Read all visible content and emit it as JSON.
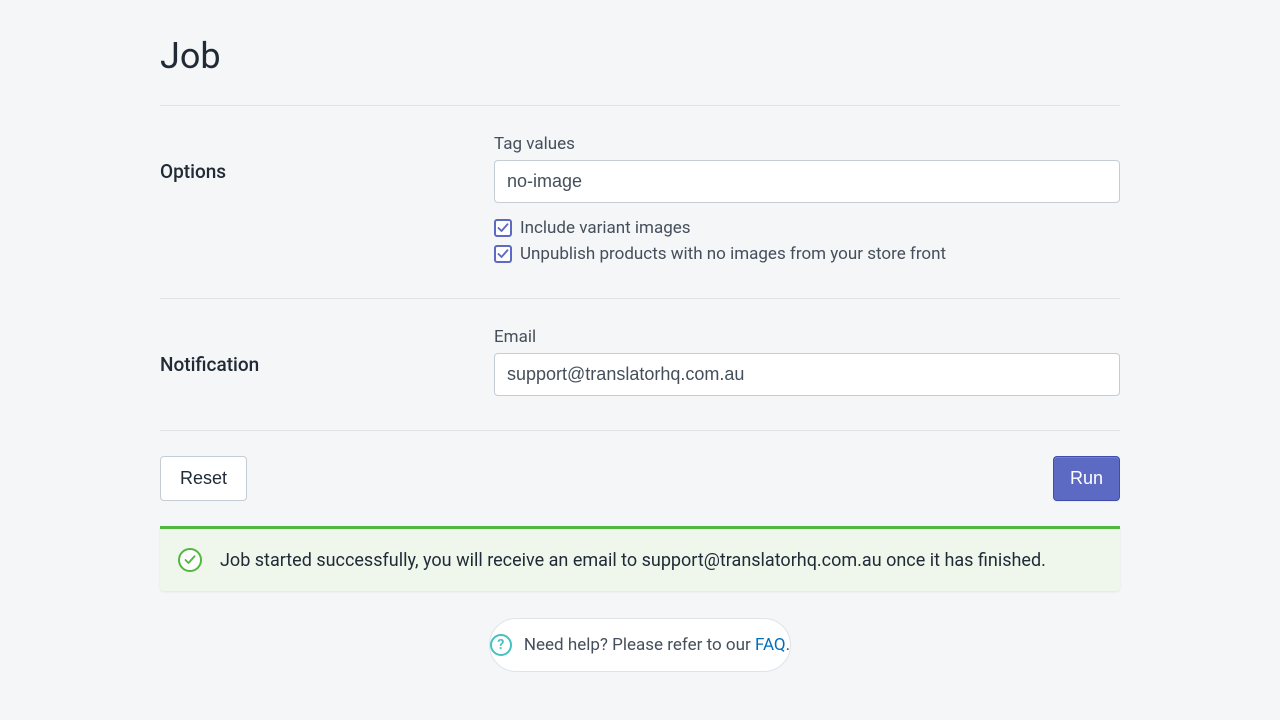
{
  "page_title": "Job",
  "options": {
    "section_label": "Options",
    "tag_values_label": "Tag values",
    "tag_values_value": "no-image",
    "include_variant_label": "Include variant images",
    "include_variant_checked": true,
    "unpublish_label": "Unpublish products with no images from your store front",
    "unpublish_checked": true
  },
  "notification": {
    "section_label": "Notification",
    "email_label": "Email",
    "email_value": "support@translatorhq.com.au"
  },
  "actions": {
    "reset_label": "Reset",
    "run_label": "Run"
  },
  "banner": {
    "message": "Job started successfully, you will receive an email to support@translatorhq.com.au once it has finished."
  },
  "help": {
    "prefix": "Need help? Please refer to our ",
    "link_text": "FAQ",
    "suffix": "."
  }
}
